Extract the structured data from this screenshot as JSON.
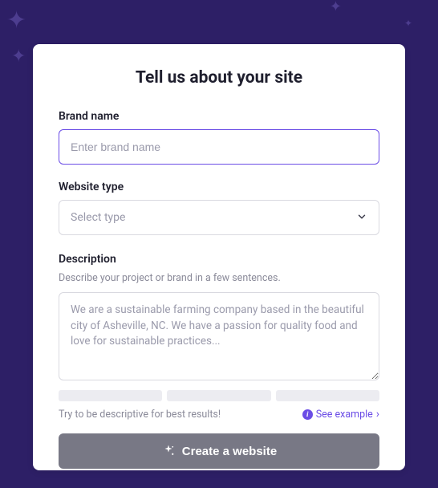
{
  "title": "Tell us about your site",
  "brand": {
    "label": "Brand name",
    "placeholder": "Enter brand name"
  },
  "websiteType": {
    "label": "Website type",
    "placeholder": "Select type"
  },
  "description": {
    "label": "Description",
    "help": "Describe your project or brand in a few sentences.",
    "placeholder": "We are a sustainable farming company based in the beautiful city of Asheville, NC. We have a passion for quality food and love for sustainable practices..."
  },
  "tips": {
    "left": "Try to be descriptive for best results!",
    "right": "See example"
  },
  "cta": "Create a website"
}
